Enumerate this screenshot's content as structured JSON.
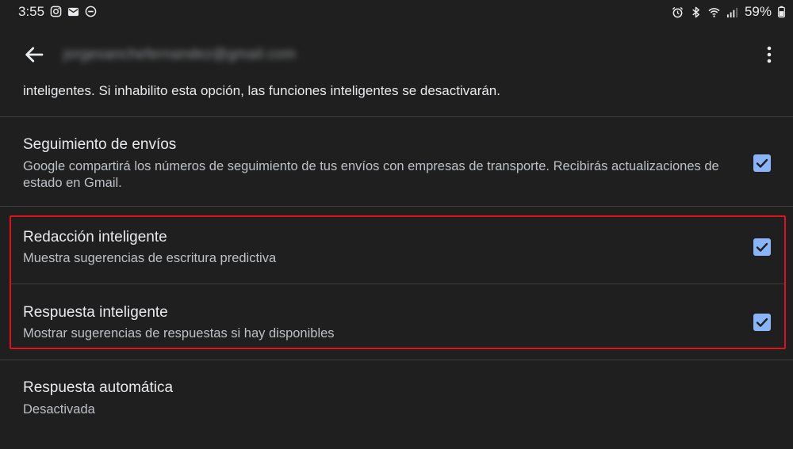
{
  "status_bar": {
    "time": "3:55",
    "battery": "59%",
    "left_icons": [
      "instagram-icon",
      "mail-notification-icon",
      "do-not-disturb-icon"
    ],
    "right_icons": [
      "alarm-icon",
      "bluetooth-icon",
      "wifi-icon",
      "signal-icon",
      "battery-icon"
    ]
  },
  "app_bar": {
    "account": "jorgesanchefernandez@gmail.com"
  },
  "intro": {
    "text": "inteligentes. Si inhabilito esta opción, las funciones inteligentes se desactivarán."
  },
  "settings": [
    {
      "title": "Seguimiento de envíos",
      "description": "Google compartirá los números de seguimiento de tus envíos con empresas de transporte. Recibirás actualizaciones de estado en Gmail.",
      "checked": true
    },
    {
      "title": "Redacción inteligente",
      "description": "Muestra sugerencias de escritura predictiva",
      "checked": true
    },
    {
      "title": "Respuesta inteligente",
      "description": "Mostrar sugerencias de respuestas si hay disponibles",
      "checked": true
    },
    {
      "title": "Respuesta automática",
      "description": "Desactivada"
    }
  ],
  "colors": {
    "background": "#1f1f1f",
    "checkbox": "#8ab4f8",
    "highlight": "#e0111b"
  }
}
